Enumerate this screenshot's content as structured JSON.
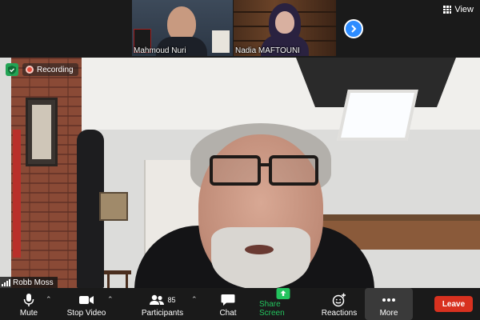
{
  "gallery": {
    "participants": [
      {
        "name": "Mahmoud Nuri",
        "label_color": "#ffffff"
      },
      {
        "name": "Nadia MAFTOUNI",
        "label_color": "#ffffff"
      }
    ],
    "view_label": "View",
    "next_icon": "chevron-right-icon"
  },
  "main_video": {
    "speaker_name": "Robb Moss",
    "recording_label": "Recording",
    "security_icon": "shield-icon"
  },
  "toolbar": {
    "mute_label": "Mute",
    "stop_video_label": "Stop Video",
    "participants_label": "Participants",
    "participants_count": "85",
    "chat_label": "Chat",
    "share_screen_label": "Share Screen",
    "reactions_label": "Reactions",
    "more_label": "More",
    "leave_label": "Leave"
  },
  "colors": {
    "accent": "#2d8cff",
    "share_green": "#23c45e",
    "leave_red": "#d8311f",
    "toolbar_bg": "#1a1a1a"
  }
}
